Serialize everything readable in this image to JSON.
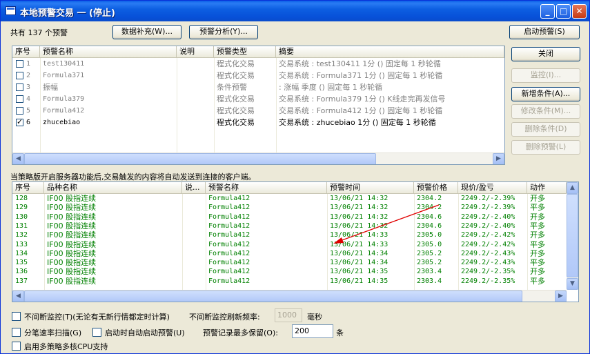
{
  "window": {
    "title": "本地预警交易 一 (停止)"
  },
  "title_buttons": {
    "min": "_",
    "max": "□",
    "close": "✕"
  },
  "toolbar": {
    "count_label": "共有 137 个预警",
    "supplement_button": "数据补充(W)...",
    "analysis_button": "预警分析(Y)...",
    "start_button": "启动预警(S)"
  },
  "side_buttons": {
    "close": "关闭",
    "monitor": "监控(I)...",
    "add_condition": "新增条件(A)...",
    "edit_condition": "修改条件(M)...",
    "delete_condition": "删除条件(D)",
    "delete_alert": "删除预警(L)"
  },
  "alert_table": {
    "headers": [
      "序号",
      "预警名称",
      "说明",
      "预警类型",
      "摘要"
    ],
    "rows": [
      {
        "no": "1",
        "name": "test130411",
        "desc": "",
        "type": "程式化交易",
        "summary": "交易系统 : test130411 1分 () 固定每 1 秒轮循",
        "checked": false,
        "active": false
      },
      {
        "no": "2",
        "name": "Formula371",
        "desc": "",
        "type": "程式化交易",
        "summary": "交易系统 : Formula371 1分 () 固定每 1 秒轮循",
        "checked": false,
        "active": false
      },
      {
        "no": "3",
        "name": "振幅",
        "desc": "",
        "type": "条件预警",
        "summary": " : 涨幅 季度 () 固定每 1 秒轮循",
        "checked": false,
        "active": false
      },
      {
        "no": "4",
        "name": "Formula379",
        "desc": "",
        "type": "程式化交易",
        "summary": "交易系统 : Formula379 1分 () K线走完再发信号",
        "checked": false,
        "active": false
      },
      {
        "no": "5",
        "name": "Formula412",
        "desc": "",
        "type": "程式化交易",
        "summary": "交易系统 : Formula412 1分 () 固定每 1 秒轮循",
        "checked": false,
        "active": false
      },
      {
        "no": "6",
        "name": "zhucebiao",
        "desc": "",
        "type": "程式化交易",
        "summary": "交易系统 : zhucebiao 1分 () 固定每 1 秒轮循",
        "checked": true,
        "active": true
      }
    ]
  },
  "info_text": "当策略版开启服务器功能后,交易触发的内容将自动发送到连接的客户端。",
  "signal_table": {
    "headers": [
      "序号",
      "品种名称",
      "说...",
      "预警名称",
      "预警时间",
      "预警价格",
      "现价/盈亏",
      "动作"
    ],
    "rows": [
      {
        "no": "128",
        "product": "IF00 股指连续",
        "note": "",
        "alert": "Formula412",
        "time": "13/06/21 14:32",
        "price": "2304.2",
        "pnl": "2249.2/-2.39%",
        "action": "开多"
      },
      {
        "no": "129",
        "product": "IF00 股指连续",
        "note": "",
        "alert": "Formula412",
        "time": "13/06/21 14:32",
        "price": "2304.2",
        "pnl": "2249.2/-2.39%",
        "action": "平多"
      },
      {
        "no": "130",
        "product": "IF00 股指连续",
        "note": "",
        "alert": "Formula412",
        "time": "13/06/21 14:32",
        "price": "2304.6",
        "pnl": "2249.2/-2.40%",
        "action": "开多"
      },
      {
        "no": "131",
        "product": "IF00 股指连续",
        "note": "",
        "alert": "Formula412",
        "time": "13/06/21 14:32",
        "price": "2304.6",
        "pnl": "2249.2/-2.40%",
        "action": "平多"
      },
      {
        "no": "132",
        "product": "IF00 股指连续",
        "note": "",
        "alert": "Formula412",
        "time": "13/06/21 14:33",
        "price": "2305.0",
        "pnl": "2249.2/-2.42%",
        "action": "开多"
      },
      {
        "no": "133",
        "product": "IF00 股指连续",
        "note": "",
        "alert": "Formula412",
        "time": "13/06/21 14:33",
        "price": "2305.0",
        "pnl": "2249.2/-2.42%",
        "action": "平多"
      },
      {
        "no": "134",
        "product": "IF00 股指连续",
        "note": "",
        "alert": "Formula412",
        "time": "13/06/21 14:34",
        "price": "2305.2",
        "pnl": "2249.2/-2.43%",
        "action": "开多"
      },
      {
        "no": "135",
        "product": "IF00 股指连续",
        "note": "",
        "alert": "Formula412",
        "time": "13/06/21 14:34",
        "price": "2305.2",
        "pnl": "2249.2/-2.43%",
        "action": "平多"
      },
      {
        "no": "136",
        "product": "IF00 股指连续",
        "note": "",
        "alert": "Formula412",
        "time": "13/06/21 14:35",
        "price": "2303.4",
        "pnl": "2249.2/-2.35%",
        "action": "开多"
      },
      {
        "no": "137",
        "product": "IF00 股指连续",
        "note": "",
        "alert": "Formula412",
        "time": "13/06/21 14:35",
        "price": "2303.4",
        "pnl": "2249.2/-2.35%",
        "action": "平多"
      }
    ]
  },
  "options": {
    "continuous_monitor": "不间断监控(T)(无论有无新行情都定时计算)",
    "refresh_label": "不间断监控刷新频率:",
    "refresh_value": "1000",
    "refresh_unit": "毫秒",
    "split_scan": "分笔速率扫描(G)",
    "auto_start": "启动时自动启动预警(U)",
    "max_records_label": "预警记录最多保留(O):",
    "max_records_value": "200",
    "max_records_unit": "条",
    "multicore": "启用多策略多核CPU支持"
  },
  "colors": {
    "signal_text": "#008000",
    "arrow": "#e00000",
    "title_blue": "#0a5ee6"
  }
}
